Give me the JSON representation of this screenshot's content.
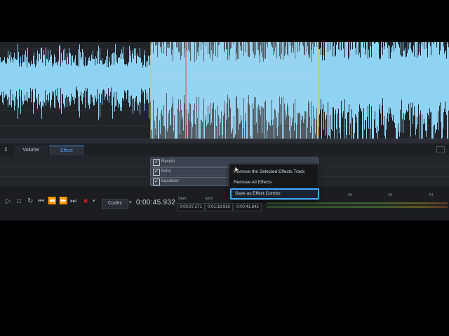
{
  "tabs": [
    {
      "label": "Volume"
    },
    {
      "label": "Effect"
    }
  ],
  "effects": [
    {
      "label": "Reverb",
      "checked": true
    },
    {
      "label": "Echo",
      "checked": true
    },
    {
      "label": "Equalizer",
      "checked": true
    }
  ],
  "context_menu": {
    "items": [
      {
        "label": "Remove the Selected Effects Track"
      },
      {
        "label": "Remove All Effects"
      },
      {
        "label": "Save as Effect Combo",
        "highlighted": true
      }
    ]
  },
  "transport": {
    "codec_label": "Codec",
    "current_time": "0:00:45.932",
    "start_label": "Start",
    "start_time": "0:00:37.271",
    "end_label": "End",
    "end_time": "0:01:18.916",
    "duration_time": "0:00:41.645"
  },
  "meter": {
    "ticks": [
      "-48",
      "-36",
      "-24"
    ]
  },
  "colors": {
    "waveform": "#8fd3f4",
    "selection": "#9fd8f0",
    "playhead": "#ff3b3b",
    "accent": "#3fa9ff",
    "record": "#c0191e"
  },
  "icons": {
    "play": "play-icon",
    "stop": "stop-icon",
    "loop": "loop-icon",
    "skip_back": "skip-back-icon",
    "rewind": "rewind-icon",
    "fast_forward": "fast-forward-icon",
    "skip_forward": "skip-forward-icon",
    "record": "record-icon"
  }
}
